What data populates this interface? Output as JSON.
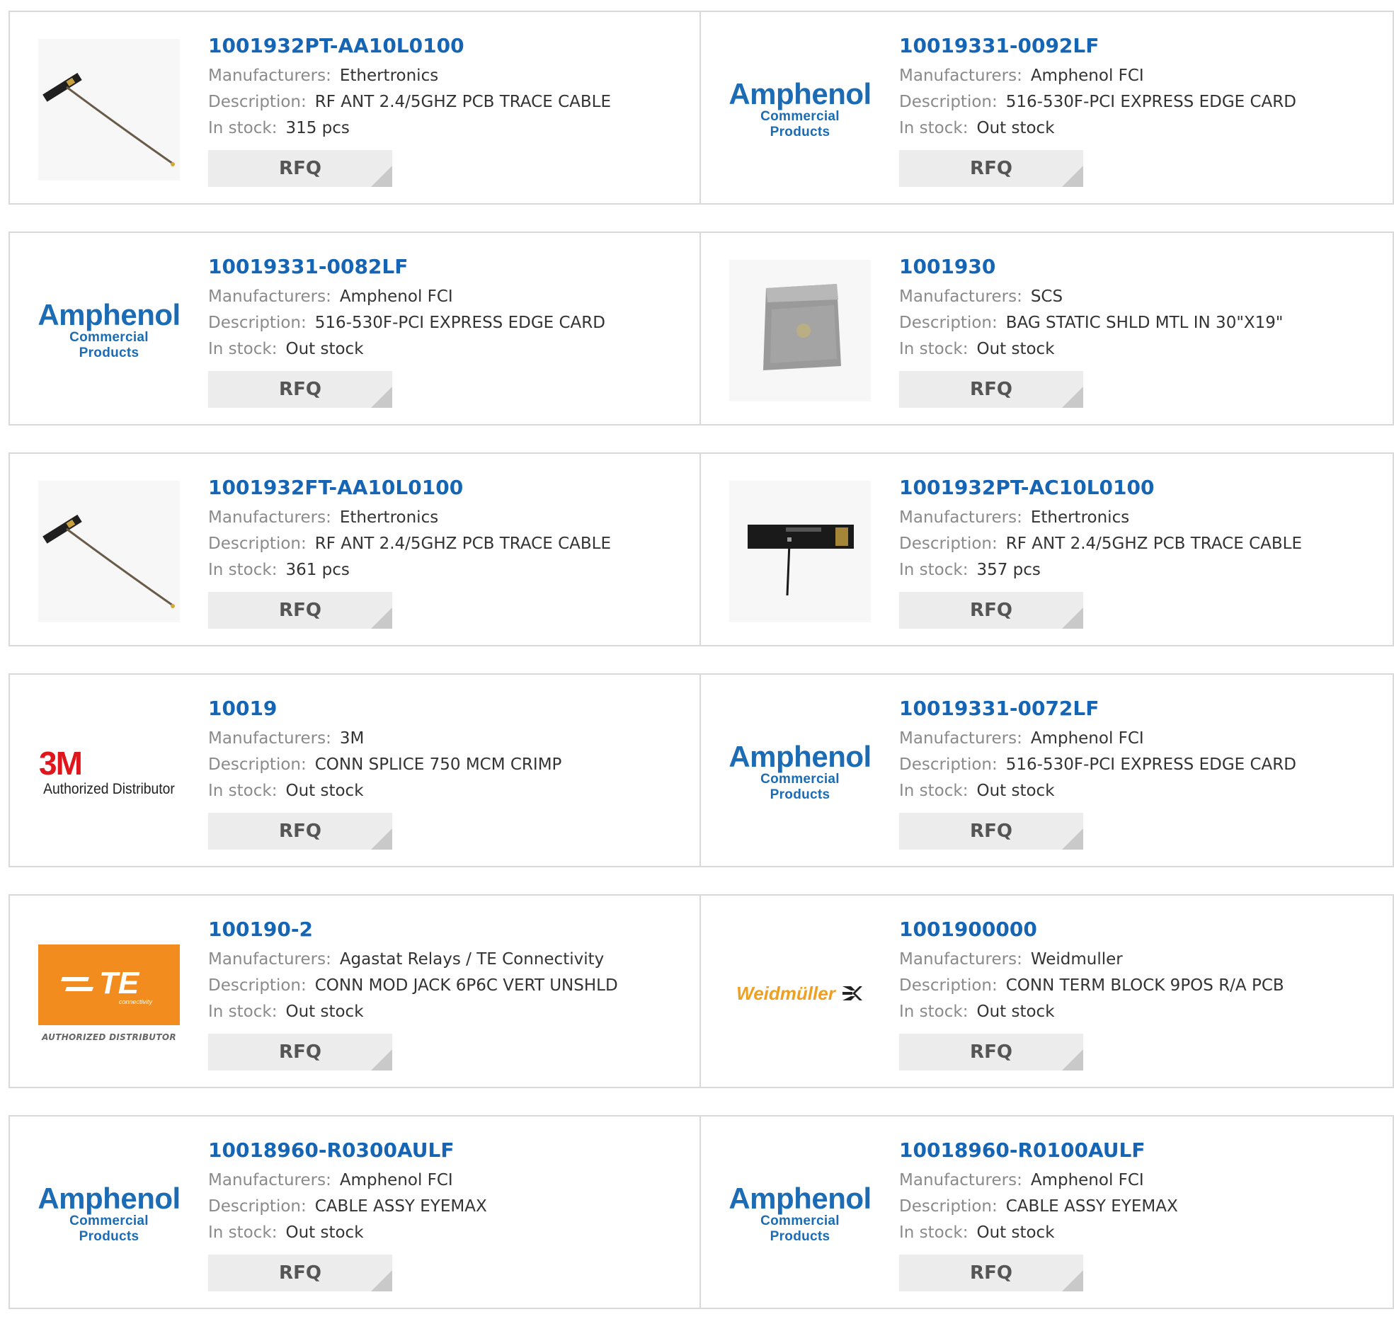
{
  "labels": {
    "manufacturers": "Manufacturers:",
    "description": "Description:",
    "in_stock": "In stock:",
    "rfq": "RFQ"
  },
  "logos": {
    "amphenol": {
      "name": "Amphenol",
      "sub": "Commercial Products",
      "color": "#1b6cb5"
    },
    "3m": {
      "name": "3M",
      "sub": "Authorized Distributor",
      "color": "#e0161d"
    },
    "te": {
      "name": "TE",
      "sub_small": "connectivity",
      "sub": "AUTHORIZED DISTRIBUTOR",
      "color": "#f28c1e"
    },
    "weidmuller": {
      "name": "Weidmüller",
      "color": "#f0a020"
    }
  },
  "products": [
    {
      "part": "1001932PT-AA10L0100",
      "manufacturer": "Ethertronics",
      "description": "RF ANT 2.4/5GHZ PCB TRACE CABLE",
      "stock": "315 pcs",
      "image": "antenna-cable-photo"
    },
    {
      "part": "10019331-0092LF",
      "manufacturer": "Amphenol FCI",
      "description": "516-530F-PCI EXPRESS EDGE CARD",
      "stock": "Out stock",
      "image": "amphenol-logo"
    },
    {
      "part": "10019331-0082LF",
      "manufacturer": "Amphenol FCI",
      "description": "516-530F-PCI EXPRESS EDGE CARD",
      "stock": "Out stock",
      "image": "amphenol-logo"
    },
    {
      "part": "1001930",
      "manufacturer": "SCS",
      "description": "BAG STATIC SHLD MTL IN 30\"X19\"",
      "stock": "Out stock",
      "image": "static-bag-photo"
    },
    {
      "part": "1001932FT-AA10L0100",
      "manufacturer": "Ethertronics",
      "description": "RF ANT 2.4/5GHZ PCB TRACE CABLE",
      "stock": "361 pcs",
      "image": "antenna-cable-photo"
    },
    {
      "part": "1001932PT-AC10L0100",
      "manufacturer": "Ethertronics",
      "description": "RF ANT 2.4/5GHZ PCB TRACE CABLE",
      "stock": "357 pcs",
      "image": "antenna-pcb-photo"
    },
    {
      "part": "10019",
      "manufacturer": "3M",
      "description": "CONN SPLICE 750 MCM CRIMP",
      "stock": "Out stock",
      "image": "3m-logo"
    },
    {
      "part": "10019331-0072LF",
      "manufacturer": "Amphenol FCI",
      "description": "516-530F-PCI EXPRESS EDGE CARD",
      "stock": "Out stock",
      "image": "amphenol-logo"
    },
    {
      "part": "100190-2",
      "manufacturer": "Agastat Relays / TE Connectivity",
      "description": "CONN MOD JACK 6P6C VERT UNSHLD",
      "stock": "Out stock",
      "image": "te-logo"
    },
    {
      "part": "1001900000",
      "manufacturer": "Weidmuller",
      "description": "CONN TERM BLOCK 9POS R/A PCB",
      "stock": "Out stock",
      "image": "weidmuller-logo"
    },
    {
      "part": "10018960-R0300AULF",
      "manufacturer": "Amphenol FCI",
      "description": "CABLE ASSY EYEMAX",
      "stock": "Out stock",
      "image": "amphenol-logo"
    },
    {
      "part": "10018960-R0100AULF",
      "manufacturer": "Amphenol FCI",
      "description": "CABLE ASSY EYEMAX",
      "stock": "Out stock",
      "image": "amphenol-logo"
    }
  ]
}
